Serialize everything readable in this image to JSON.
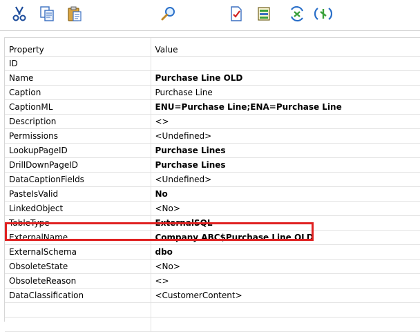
{
  "toolbar": {
    "buttons": [
      {
        "icon": "cut-icon"
      },
      {
        "icon": "copy-icon"
      },
      {
        "icon": "paste-icon"
      },
      {
        "icon": "find-icon"
      },
      {
        "icon": "check-document-icon"
      },
      {
        "icon": "properties-icon"
      },
      {
        "icon": "refresh-icon"
      },
      {
        "icon": "connect-icon"
      }
    ]
  },
  "grid": {
    "headers": {
      "property": "Property",
      "value": "Value"
    },
    "rows": [
      {
        "property": "ID",
        "value": "",
        "bold": false
      },
      {
        "property": "Name",
        "value": "Purchase Line OLD",
        "bold": true
      },
      {
        "property": "Caption",
        "value": "Purchase Line",
        "bold": false
      },
      {
        "property": "CaptionML",
        "value": "ENU=Purchase Line;ENA=Purchase Line",
        "bold": true
      },
      {
        "property": "Description",
        "value": "<>",
        "bold": false
      },
      {
        "property": "Permissions",
        "value": "<Undefined>",
        "bold": false
      },
      {
        "property": "LookupPageID",
        "value": "Purchase Lines",
        "bold": true
      },
      {
        "property": "DrillDownPageID",
        "value": "Purchase Lines",
        "bold": true
      },
      {
        "property": "DataCaptionFields",
        "value": "<Undefined>",
        "bold": false
      },
      {
        "property": "PasteIsValid",
        "value": "No",
        "bold": true
      },
      {
        "property": "LinkedObject",
        "value": "<No>",
        "bold": false
      },
      {
        "property": "TableType",
        "value": "ExternalSQL",
        "bold": true
      },
      {
        "property": "ExternalName",
        "value": "Company ABC$Purchase Line OLD",
        "bold": true
      },
      {
        "property": "ExternalSchema",
        "value": "dbo",
        "bold": true
      },
      {
        "property": "ObsoleteState",
        "value": "<No>",
        "bold": false
      },
      {
        "property": "ObsoleteReason",
        "value": "<>",
        "bold": false
      },
      {
        "property": "DataClassification",
        "value": "<CustomerContent>",
        "bold": false
      },
      {
        "property": "",
        "value": "",
        "bold": false
      },
      {
        "property": "",
        "value": "",
        "bold": false
      }
    ]
  },
  "highlight_color": "#e02020"
}
